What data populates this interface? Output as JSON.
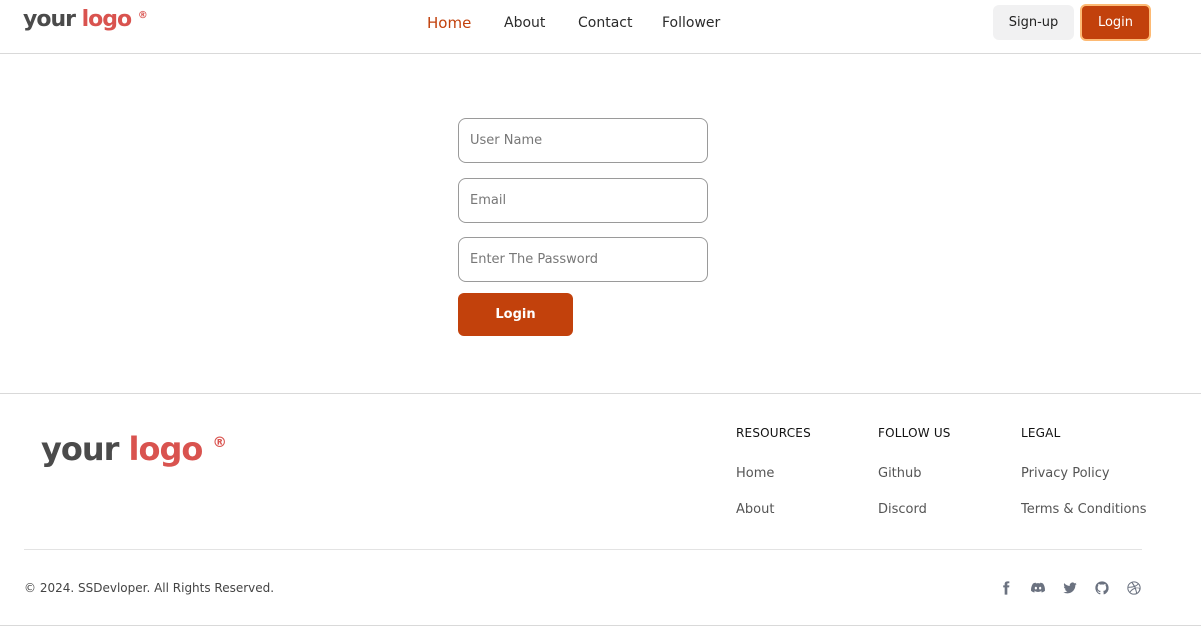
{
  "header": {
    "logo": {
      "word1": "your",
      "word2": "logo",
      "mark": "®"
    },
    "nav": [
      {
        "label": "Home",
        "active": true
      },
      {
        "label": "About"
      },
      {
        "label": "Contact"
      },
      {
        "label": "Follower"
      }
    ],
    "signup_label": "Sign-up",
    "login_label": "Login"
  },
  "form": {
    "username_placeholder": "User Name",
    "username_value": "",
    "email_placeholder": "Email",
    "email_value": "",
    "password_placeholder": "Enter The Password",
    "password_value": "",
    "submit_label": "Login"
  },
  "footer": {
    "logo": {
      "word1": "your",
      "word2": "logo",
      "mark": "®"
    },
    "columns": [
      {
        "title": "Resources",
        "links": [
          "Home",
          "About"
        ]
      },
      {
        "title": "Follow us",
        "links": [
          "Github",
          "Discord"
        ]
      },
      {
        "title": "Legal",
        "links": [
          "Privacy Policy",
          "Terms & Conditions"
        ]
      }
    ],
    "copyright": "© 2024. SSDevloper. All Rights Reserved.",
    "social_icons": [
      "facebook-icon",
      "discord-icon",
      "twitter-icon",
      "github-icon",
      "dribbble-icon"
    ]
  },
  "colors": {
    "accent": "#c2410c",
    "accent_ring": "#fdba74",
    "logo_brand": "#d9534f",
    "logo_dark": "#4b4b4b"
  }
}
